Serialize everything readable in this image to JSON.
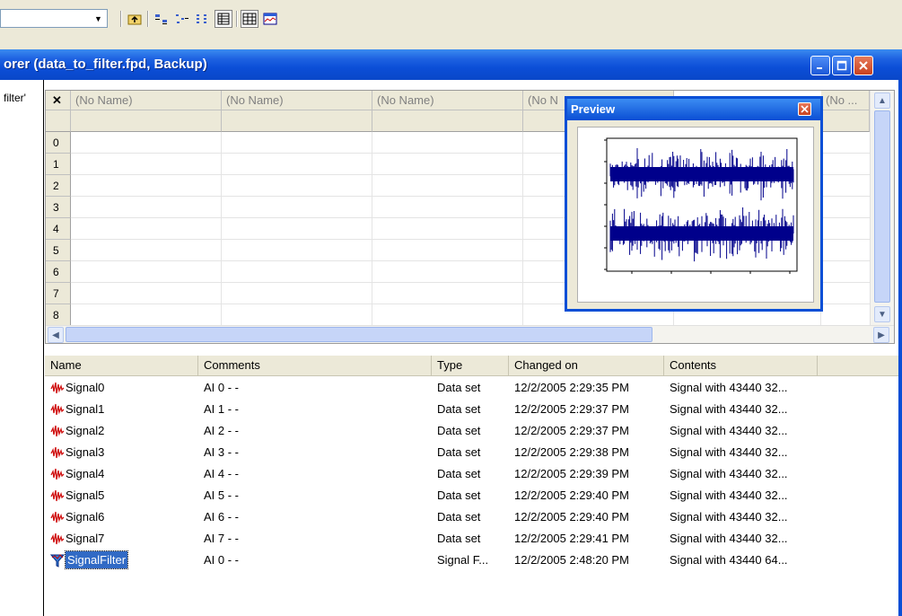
{
  "window": {
    "title": "orer (data_to_filter.fpd, Backup)"
  },
  "left_pane": {
    "label": "filter'"
  },
  "grid": {
    "corner_symbol": "✕",
    "columns": [
      "(No Name)",
      "(No Name)",
      "(No Name)",
      "(No N",
      "(No ..."
    ],
    "row_numbers": [
      "0",
      "1",
      "2",
      "3",
      "4",
      "5",
      "6",
      "7",
      "8"
    ]
  },
  "preview": {
    "title": "Preview"
  },
  "list": {
    "columns": [
      "Name",
      "Comments",
      "Type",
      "Changed on",
      "Contents"
    ],
    "rows": [
      {
        "name": "Signal0",
        "comments": "AI 0 - -",
        "type": "Data set",
        "changed": "12/2/2005 2:29:35 PM",
        "contents": "Signal with 43440 32...",
        "icon": "signal-icon",
        "selected": false
      },
      {
        "name": "Signal1",
        "comments": "AI 1 - -",
        "type": "Data set",
        "changed": "12/2/2005 2:29:37 PM",
        "contents": "Signal with 43440 32...",
        "icon": "signal-icon",
        "selected": false
      },
      {
        "name": "Signal2",
        "comments": "AI 2 - -",
        "type": "Data set",
        "changed": "12/2/2005 2:29:37 PM",
        "contents": "Signal with 43440 32...",
        "icon": "signal-icon",
        "selected": false
      },
      {
        "name": "Signal3",
        "comments": "AI 3 - -",
        "type": "Data set",
        "changed": "12/2/2005 2:29:38 PM",
        "contents": "Signal with 43440 32...",
        "icon": "signal-icon",
        "selected": false
      },
      {
        "name": "Signal4",
        "comments": "AI 4 - -",
        "type": "Data set",
        "changed": "12/2/2005 2:29:39 PM",
        "contents": "Signal with 43440 32...",
        "icon": "signal-icon",
        "selected": false
      },
      {
        "name": "Signal5",
        "comments": "AI 5 - -",
        "type": "Data set",
        "changed": "12/2/2005 2:29:40 PM",
        "contents": "Signal with 43440 32...",
        "icon": "signal-icon",
        "selected": false
      },
      {
        "name": "Signal6",
        "comments": "AI 6 - -",
        "type": "Data set",
        "changed": "12/2/2005 2:29:40 PM",
        "contents": "Signal with 43440 32...",
        "icon": "signal-icon",
        "selected": false
      },
      {
        "name": "Signal7",
        "comments": "AI 7 - -",
        "type": "Data set",
        "changed": "12/2/2005 2:29:41 PM",
        "contents": "Signal with 43440 32...",
        "icon": "signal-icon",
        "selected": false
      },
      {
        "name": "SignalFilter",
        "comments": "AI 0 - -",
        "type": "Signal F...",
        "changed": "12/2/2005 2:48:20 PM",
        "contents": "Signal with 43440 64...",
        "icon": "filter-icon",
        "selected": true
      }
    ]
  },
  "colors": {
    "titlebar": "#0a4fd6",
    "selection": "#316ac5",
    "signal_trace": "#00008b"
  }
}
